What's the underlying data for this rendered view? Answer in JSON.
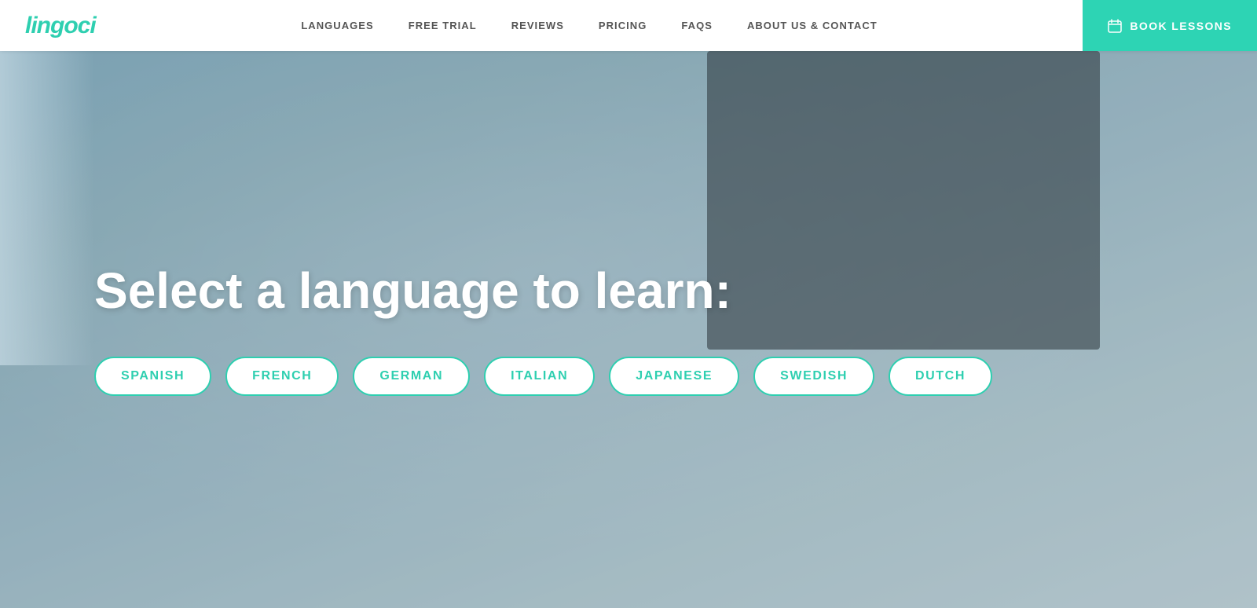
{
  "logo": {
    "text": "lingoci"
  },
  "nav": {
    "links": [
      {
        "label": "LANGUAGES",
        "id": "languages"
      },
      {
        "label": "FREE TRIAL",
        "id": "free-trial"
      },
      {
        "label": "REVIEWS",
        "id": "reviews"
      },
      {
        "label": "PRICING",
        "id": "pricing"
      },
      {
        "label": "FAQS",
        "id": "faqs"
      },
      {
        "label": "ABOUT US & CONTACT",
        "id": "about"
      }
    ],
    "cta_label": "BOOK LESSONS",
    "cta_icon": "calendar-icon"
  },
  "hero": {
    "title": "Select a language to learn:",
    "languages": [
      {
        "label": "SPANISH"
      },
      {
        "label": "FRENCH"
      },
      {
        "label": "GERMAN"
      },
      {
        "label": "ITALIAN"
      },
      {
        "label": "JAPANESE"
      },
      {
        "label": "SWEDISH"
      },
      {
        "label": "DUTCH"
      }
    ]
  },
  "colors": {
    "teal": "#2ecfb0",
    "teal_dark": "#25bea0",
    "white": "#ffffff",
    "nav_text": "#555555"
  }
}
